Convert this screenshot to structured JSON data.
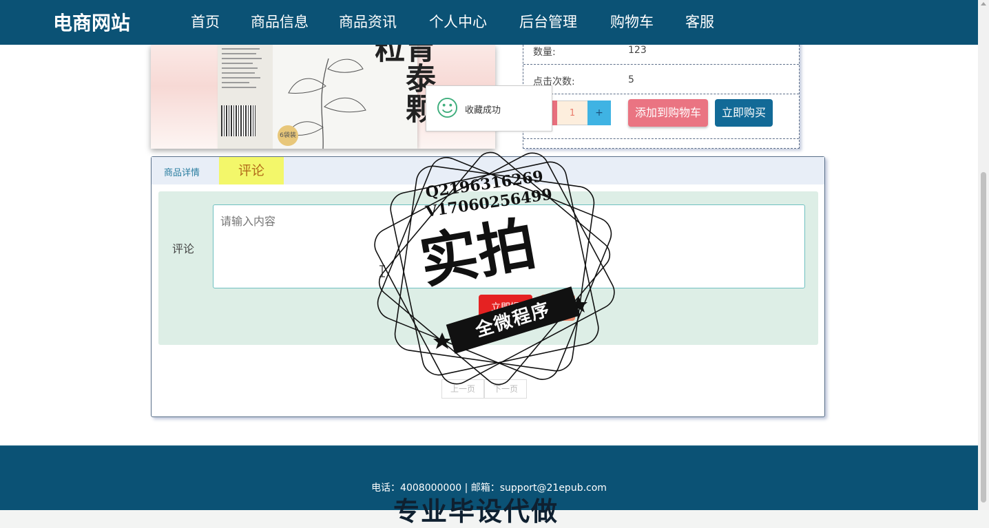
{
  "brand": "电商网站",
  "nav": [
    "首页",
    "商品信息",
    "商品资讯",
    "个人中心",
    "后台管理",
    "购物车",
    "客服"
  ],
  "product_image": {
    "chars": "胃泰颗粒",
    "badge": "6袋装"
  },
  "product_info": [
    {
      "label": "数量:",
      "value": "123"
    },
    {
      "label": "点击次数:",
      "value": "5"
    }
  ],
  "quantity": {
    "value": "1",
    "plus": "+"
  },
  "buttons": {
    "add_to_cart": "添加到购物车",
    "buy_now": "立即购买"
  },
  "toast": {
    "text": "收藏成功"
  },
  "tabs": {
    "detail": "商品详情",
    "comment": "评论"
  },
  "comment_form": {
    "label": "评论",
    "placeholder": "请输入内容",
    "submit": "立即提",
    "reset": "重"
  },
  "pager": {
    "prev": "上一页",
    "next": "下一页"
  },
  "footer": {
    "contact": "电话：4008000000 | 邮箱：support@21epub.com",
    "overlay": "专业毕设代做"
  },
  "watermark": {
    "line1": "Q2196316269",
    "line2": "V17060256499",
    "big": "实拍",
    "ribbon": "全微程序"
  }
}
